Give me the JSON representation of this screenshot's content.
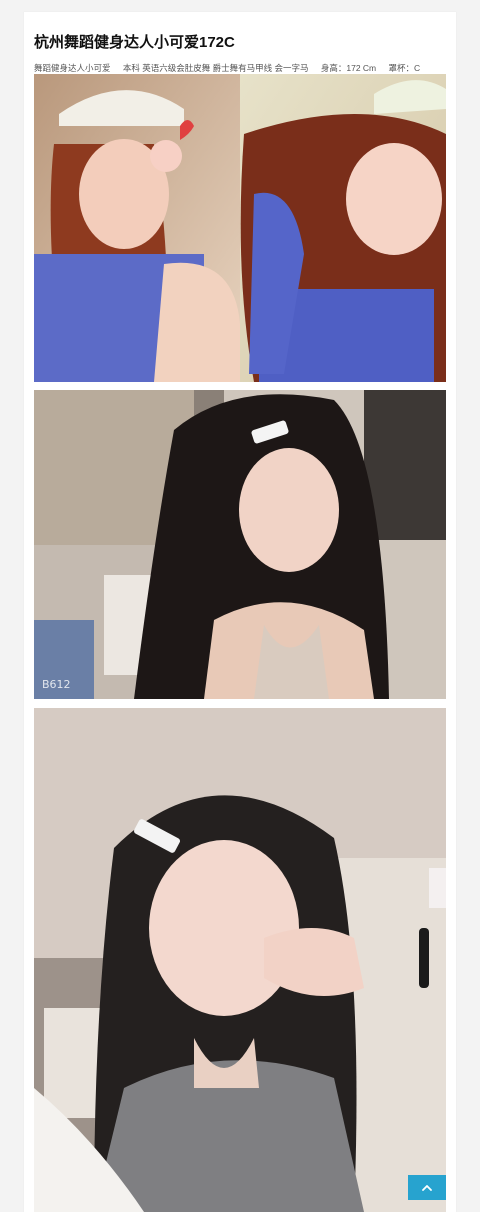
{
  "post": {
    "title": "杭州舞蹈健身达人小可爱172C",
    "tags": [
      "舞蹈健身达人小可爱",
      "本科 英语六级会肚皮舞 爵士舞有马甲线 会一字马",
      "身高：172 Cm",
      "罩杯：C"
    ]
  },
  "photos": [
    {
      "watermark": ""
    },
    {
      "watermark": "B612"
    },
    {
      "watermark": ""
    }
  ],
  "ui": {
    "scroll_top_icon": "chevron-up-icon",
    "accent_color": "#27a3cf"
  }
}
